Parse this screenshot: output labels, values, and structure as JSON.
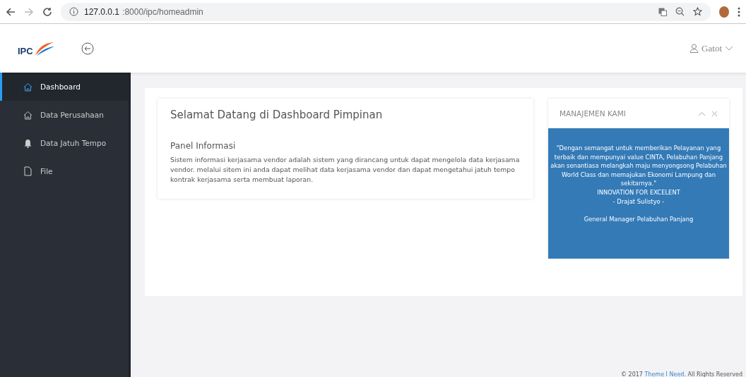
{
  "browser": {
    "url_host": "127.0.0.1",
    "url_path": ":8000/ipc/homeadmin"
  },
  "header": {
    "logo_text": "IPC",
    "user": "Gatot"
  },
  "sidebar": {
    "items": [
      {
        "label": "Dashboard",
        "kind": "home",
        "selected": true
      },
      {
        "label": "Data Perusahaan",
        "kind": "home",
        "selected": false
      },
      {
        "label": "Data Jatuh Tempo",
        "kind": "bell",
        "selected": false
      },
      {
        "label": "File",
        "kind": "file",
        "selected": false
      }
    ]
  },
  "welcome": {
    "title": "Selamat Datang di Dashboard Pimpinan",
    "subtitle": "Panel Informasi",
    "text": "Sistem informasi kerjasama vendor adalah sistem yang dirancang untuk dapat mengelola data kerjasama vendor. melalui sitem ini anda dapat melihat data kerjasama vendor dan dapat mengetahui jatuh tempo kontrak kerjasama serta membuat laporan."
  },
  "management": {
    "title": "MANAJEMEN KAMI",
    "paragraphs": [
      [
        "\"Dengan semangat untuk memberikan Pelayanan yang terbaik dan mempunyai value CINTA, Pelabuhan Panjang akan senantiasa melangkah maju menyongsong Pelabuhan World Class dan memajukan Ekonomi Lampung dan sekitarnya.\"",
        "INNOVATION FOR EXCELENT",
        "- Drajat Sulistyo -"
      ],
      [
        "General Manager Pelabuhan Panjang"
      ]
    ]
  },
  "footer": {
    "prefix": "© 2017",
    "link": "Theme I Need",
    "suffix": ". All Rights Reserved"
  }
}
